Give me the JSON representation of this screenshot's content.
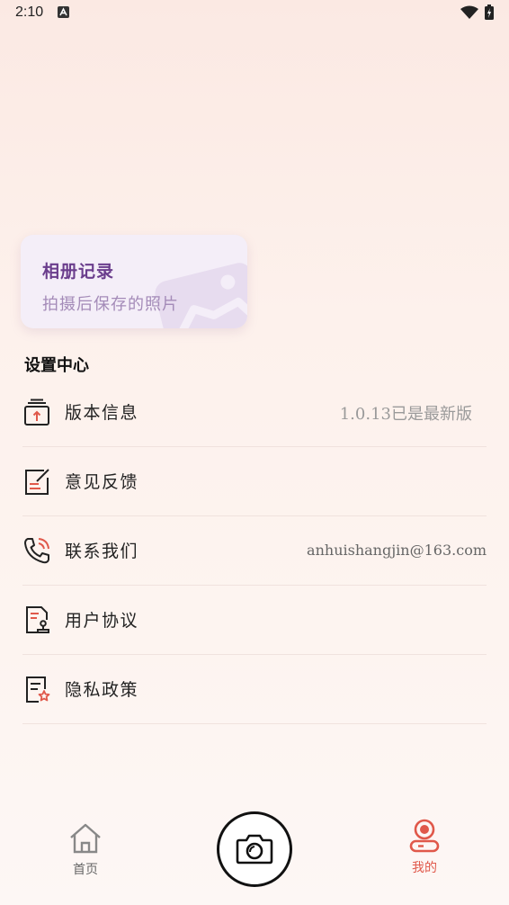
{
  "status_bar": {
    "time": "2:10"
  },
  "album": {
    "title": "相册记录",
    "subtitle": "拍摄后保存的照片"
  },
  "settings": {
    "title": "设置中心",
    "items": [
      {
        "label": "版本信息",
        "value": "1.0.13已是最新版",
        "icon": "version-icon"
      },
      {
        "label": "意见反馈",
        "value": "",
        "icon": "feedback-icon"
      },
      {
        "label": "联系我们",
        "value": "anhuishangjin@163.com",
        "icon": "phone-icon"
      },
      {
        "label": "用户协议",
        "value": "",
        "icon": "agreement-icon"
      },
      {
        "label": "隐私政策",
        "value": "",
        "icon": "privacy-icon"
      }
    ]
  },
  "nav": {
    "home_label": "首页",
    "mine_label": "我的",
    "active_color": "#e0584a"
  }
}
